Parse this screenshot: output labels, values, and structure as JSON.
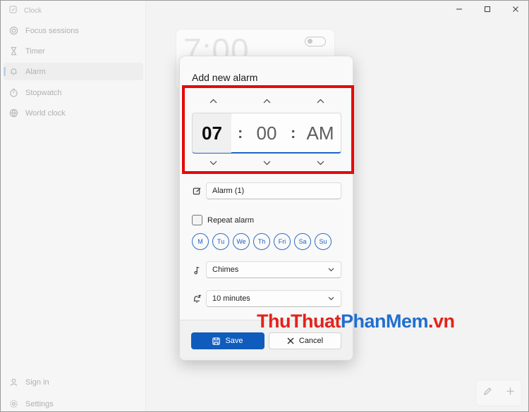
{
  "app": {
    "title": "Clock"
  },
  "sidebar": {
    "items": [
      {
        "label": "Focus sessions",
        "icon": "focus-icon"
      },
      {
        "label": "Timer",
        "icon": "hourglass-icon"
      },
      {
        "label": "Alarm",
        "icon": "bell-icon",
        "active": true
      },
      {
        "label": "Stopwatch",
        "icon": "stopwatch-icon"
      },
      {
        "label": "World clock",
        "icon": "globe-icon"
      }
    ],
    "sign_in": "Sign in",
    "settings": "Settings"
  },
  "background_alarm": {
    "time": "7:00"
  },
  "dialog": {
    "title": "Add new alarm",
    "hour": "07",
    "minute": "00",
    "period": "AM",
    "separator": ":",
    "alarm_name": "Alarm (1)",
    "repeat_label": "Repeat alarm",
    "days": [
      "M",
      "Tu",
      "We",
      "Th",
      "Fri",
      "Sa",
      "Su"
    ],
    "sound": "Chimes",
    "snooze": "10 minutes",
    "save_label": "Save",
    "cancel_label": "Cancel"
  },
  "watermark": {
    "part1": "ThuThuat",
    "part2": "PhanMem",
    "part3": ".vn"
  },
  "colors": {
    "accent": "#0f5cbd",
    "highlight": "#e50a0a"
  }
}
